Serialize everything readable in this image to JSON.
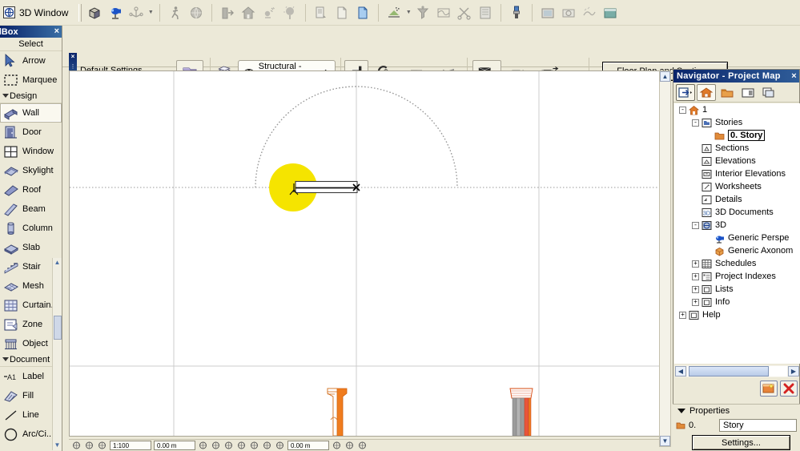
{
  "window": {
    "title": "3D Window"
  },
  "top_toolbar": {
    "groups": [
      {
        "buttons": [
          {
            "name": "3d-box-icon",
            "label": "3D Box"
          },
          {
            "name": "camera-icon",
            "label": "Camera"
          },
          {
            "name": "axis-icon",
            "label": "3D Axis",
            "dropdown": true
          }
        ]
      },
      {
        "buttons": [
          {
            "name": "walk-person-icon",
            "label": "Walk"
          },
          {
            "name": "explore-globe-icon",
            "label": "Explore"
          }
        ]
      },
      {
        "buttons": [
          {
            "name": "door-open-icon",
            "label": "Open Door"
          },
          {
            "name": "house-icon",
            "label": "House"
          },
          {
            "name": "sun-study-icon",
            "label": "Sun Study"
          },
          {
            "name": "tree-icon",
            "label": "Vegetation"
          }
        ]
      },
      {
        "buttons": [
          {
            "name": "copy-page-icon",
            "label": "Copy"
          },
          {
            "name": "new-page-icon",
            "label": "New"
          },
          {
            "name": "paste-page-icon",
            "label": "Paste"
          }
        ]
      },
      {
        "buttons": [
          {
            "name": "marquee-tool-icon",
            "label": "Marquee",
            "dropdown": true
          },
          {
            "name": "filter-icon",
            "label": "Filter"
          },
          {
            "name": "mesh-surface-icon",
            "label": "Surface"
          },
          {
            "name": "scissors-icon",
            "label": "Trim"
          },
          {
            "name": "list-panel-icon",
            "label": "List"
          }
        ]
      },
      {
        "buttons": [
          {
            "name": "paint-brush-icon",
            "label": "Paint"
          }
        ]
      },
      {
        "buttons": [
          {
            "name": "render-window-icon",
            "label": "Render"
          },
          {
            "name": "photo-render-icon",
            "label": "PhotoRender"
          },
          {
            "name": "sketch-render-icon",
            "label": "Sketch Render"
          },
          {
            "name": "teal-panel-icon",
            "label": "Background"
          }
        ]
      }
    ]
  },
  "info_bar": {
    "label": "Default Settings",
    "favorites_button": "Favorites",
    "layers_button": "Layers",
    "layer_combo": {
      "value": "Structural - Be...",
      "eye_icon": "eye-icon",
      "arrow": "▶"
    },
    "geometry_buttons": [
      {
        "name": "polywall-geometry-icon",
        "label": "Polygonal Wall",
        "dropdown": true
      },
      {
        "name": "curved-wall-icon",
        "label": "Curved Wall",
        "dropdown": true
      },
      {
        "name": "wall-left-ref-icon",
        "label": "Reference Line Left"
      },
      {
        "name": "wall-right-ref-icon",
        "label": "Reference Line Right"
      }
    ],
    "reference_buttons": [
      {
        "name": "ref-line-outside-icon",
        "label": "Outside Reference",
        "active": true
      },
      {
        "name": "ref-line-center-icon",
        "label": "Center Reference"
      },
      {
        "name": "ref-line-inside-icon",
        "label": "Inside Reference"
      }
    ],
    "plan_button": "Floor Plan and Section...",
    "close_handle": "×"
  },
  "toolbox": {
    "title": "olBox",
    "close": "×",
    "sections": [
      {
        "header": "Select",
        "has_triangle": false,
        "items": [
          {
            "label": "Arrow",
            "icon": "arrow-cursor-icon",
            "selected": false
          },
          {
            "label": "Marquee",
            "icon": "marquee-dashed-icon",
            "selected": false
          }
        ]
      },
      {
        "header": "Design",
        "has_triangle": true,
        "items": [
          {
            "label": "Wall",
            "icon": "wall-icon",
            "selected": true
          },
          {
            "label": "Door",
            "icon": "door-icon",
            "selected": false
          },
          {
            "label": "Window",
            "icon": "window-icon",
            "selected": false
          },
          {
            "label": "Skylight",
            "icon": "skylight-icon",
            "selected": false
          },
          {
            "label": "Roof",
            "icon": "roof-icon",
            "selected": false
          },
          {
            "label": "Beam",
            "icon": "beam-icon",
            "selected": false
          },
          {
            "label": "Column",
            "icon": "column-icon",
            "selected": false
          },
          {
            "label": "Slab",
            "icon": "slab-icon",
            "selected": false
          },
          {
            "label": "Stair",
            "icon": "stair-icon",
            "selected": false
          },
          {
            "label": "Mesh",
            "icon": "mesh-icon",
            "selected": false
          },
          {
            "label": "Curtain...",
            "icon": "curtain-wall-icon",
            "selected": false
          },
          {
            "label": "Zone",
            "icon": "zone-icon",
            "selected": false
          },
          {
            "label": "Object",
            "icon": "object-icon",
            "selected": false
          }
        ]
      },
      {
        "header": "Document",
        "has_triangle": true,
        "items": [
          {
            "label": "Label",
            "icon": "label-a1-icon",
            "selected": false
          },
          {
            "label": "Fill",
            "icon": "fill-hatch-icon",
            "selected": false
          },
          {
            "label": "Line",
            "icon": "line-icon",
            "selected": false
          },
          {
            "label": "Arc/Ci...",
            "icon": "arc-circle-icon",
            "selected": false
          }
        ]
      }
    ]
  },
  "navigator": {
    "title": "Navigator - Project Map",
    "close": "×",
    "toolbar_buttons": [
      {
        "name": "navigator-popup-icon",
        "label": "Navigator Preview",
        "boxed": true,
        "dropdown": true
      },
      {
        "name": "project-map-icon",
        "label": "Project Map",
        "active": true
      },
      {
        "name": "view-map-icon",
        "label": "View Map",
        "active": false
      },
      {
        "name": "layout-book-icon",
        "label": "Layout Book",
        "active": false
      },
      {
        "name": "publisher-sets-icon",
        "label": "Publisher Sets",
        "active": false
      }
    ],
    "tree": [
      {
        "label": "1",
        "icon": "project-home-icon",
        "depth": 0,
        "expander": "-"
      },
      {
        "label": "Stories",
        "icon": "stories-icon",
        "depth": 1,
        "expander": "-"
      },
      {
        "label": "0. Story",
        "icon": "story-folder-icon",
        "depth": 2,
        "expander": "",
        "selected": true
      },
      {
        "label": "Sections",
        "icon": "section-icon",
        "depth": 1,
        "expander": ""
      },
      {
        "label": "Elevations",
        "icon": "elevation-icon",
        "depth": 1,
        "expander": ""
      },
      {
        "label": "Interior Elevations",
        "icon": "interior-elevation-icon",
        "depth": 1,
        "expander": ""
      },
      {
        "label": "Worksheets",
        "icon": "worksheet-icon",
        "depth": 1,
        "expander": ""
      },
      {
        "label": "Details",
        "icon": "detail-icon",
        "depth": 1,
        "expander": ""
      },
      {
        "label": "3D Documents",
        "icon": "three-d-document-icon",
        "depth": 1,
        "expander": ""
      },
      {
        "label": "3D",
        "icon": "three-d-icon",
        "depth": 1,
        "expander": "-"
      },
      {
        "label": "Generic Perspe",
        "icon": "generic-perspective-icon",
        "depth": 2,
        "expander": ""
      },
      {
        "label": "Generic Axonom",
        "icon": "generic-axonometry-icon",
        "depth": 2,
        "expander": ""
      },
      {
        "label": "Schedules",
        "icon": "schedules-icon",
        "depth": 1,
        "expander": "+"
      },
      {
        "label": "Project Indexes",
        "icon": "project-indexes-icon",
        "depth": 1,
        "expander": "+"
      },
      {
        "label": "Lists",
        "icon": "lists-icon",
        "depth": 1,
        "expander": "+"
      },
      {
        "label": "Info",
        "icon": "info-icon",
        "depth": 1,
        "expander": "+"
      },
      {
        "label": "Help",
        "icon": "help-icon",
        "depth": 0,
        "expander": "+"
      }
    ],
    "hscroll": {
      "left_arrow": "◀",
      "right_arrow": "▶"
    },
    "actions": [
      {
        "name": "new-view-icon",
        "label": "New View"
      },
      {
        "name": "delete-view-icon",
        "label": "Delete"
      }
    ]
  },
  "properties": {
    "header": "Properties",
    "story_number": "0.",
    "story_name": "Story",
    "settings_button": "Settings..."
  },
  "statusbar": {
    "items": [
      {
        "name": "pointer-status-icon",
        "type": "icon"
      },
      {
        "name": "pan-hand-icon",
        "type": "icon"
      },
      {
        "name": "zoom-window-icon",
        "type": "icon"
      },
      {
        "name": "scale-field",
        "type": "field",
        "value": "1:100"
      },
      {
        "name": "elevation-field",
        "type": "field",
        "value": "0.00 m"
      },
      {
        "name": "snap-dropdown",
        "type": "icon"
      },
      {
        "name": "grid-snap-icon",
        "type": "icon"
      },
      {
        "name": "circle-snap-icon",
        "type": "icon"
      },
      {
        "name": "arc-snap-icon",
        "type": "icon"
      },
      {
        "name": "gravity-icon",
        "type": "icon"
      },
      {
        "name": "target-snap-icon",
        "type": "icon"
      },
      {
        "name": "rotate-icon",
        "type": "icon"
      },
      {
        "name": "coordinate-field",
        "type": "field",
        "value": "0.00 m"
      },
      {
        "name": "magnify-icon",
        "type": "icon"
      },
      {
        "name": "globe-icon",
        "type": "icon"
      },
      {
        "name": "help-status-icon",
        "type": "icon"
      }
    ]
  },
  "canvas": {
    "background": "#ffffff",
    "highlight_color": "#f5e400",
    "guide_color": "#b4b4b4",
    "wall_stroke": "#000000",
    "column_orange": "#f07c1e",
    "column_gray": "#808080",
    "elements": {
      "dome_arc": "dashed semicircle guide",
      "horizontal_axis": "dashed horizontal guide line",
      "vertical_axis": "thin vertical guide line",
      "yellow_highlight": "yellow snap highlight circle",
      "wall_segment": "selected wall being drawn",
      "start_marker": "wall start node",
      "end_marker": "x crosshair endpoint",
      "left_object": "orange column elevation",
      "right_object": "gray and orange column elevation"
    }
  }
}
